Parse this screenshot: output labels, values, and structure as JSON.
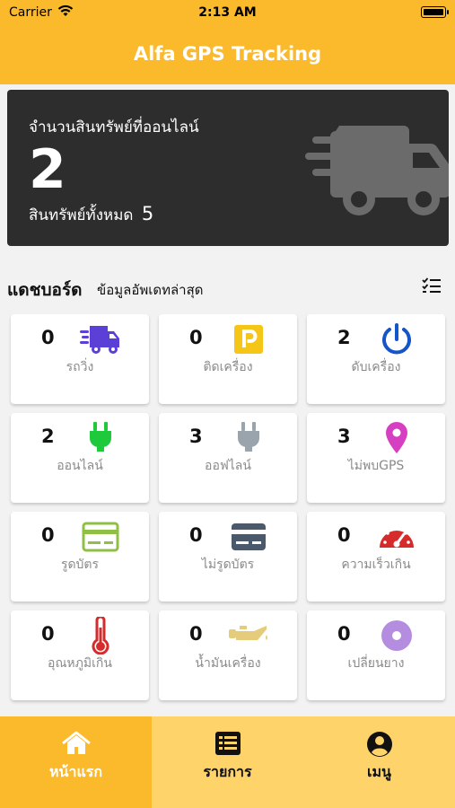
{
  "status_bar": {
    "carrier": "Carrier",
    "time": "2:13 AM"
  },
  "nav": {
    "title": "Alfa GPS Tracking"
  },
  "summary": {
    "online_label": "จำนวนสินทรัพย์ที่ออนไลน์",
    "online_count": "2",
    "total_label": "สินทรัพย์ทั้งหมด",
    "total_count": "5",
    "icon": "truck-icon"
  },
  "dashboard": {
    "title": "แดชบอร์ด",
    "subtitle": "ข้อมูลอัพเดทล่าสุด",
    "filter_icon": "checklist-icon"
  },
  "cards": [
    {
      "count": "0",
      "label": "รถวิ่ง",
      "icon": "moving-truck-icon",
      "color": "#5b3fd6"
    },
    {
      "count": "0",
      "label": "ติดเครื่อง",
      "icon": "parking-icon",
      "color": "#f5c518"
    },
    {
      "count": "2",
      "label": "ดับเครื่อง",
      "icon": "power-icon",
      "color": "#1455c9"
    },
    {
      "count": "2",
      "label": "ออนไลน์",
      "icon": "plug-icon",
      "color": "#1ec93c"
    },
    {
      "count": "3",
      "label": "ออฟไลน์",
      "icon": "plug-icon",
      "color": "#9aa4ad"
    },
    {
      "count": "3",
      "label": "ไม่พบGPS",
      "icon": "map-pin-icon",
      "color": "#d63fc1"
    },
    {
      "count": "0",
      "label": "รูดบัตร",
      "icon": "card-icon",
      "color": "#8fbf45"
    },
    {
      "count": "0",
      "label": "ไม่รูดบัตร",
      "icon": "card-icon",
      "color": "#4a5a6c"
    },
    {
      "count": "0",
      "label": "ความเร็วเกิน",
      "icon": "speedometer-icon",
      "color": "#d62b2b"
    },
    {
      "count": "0",
      "label": "อุณหภูมิเกิน",
      "icon": "thermometer-icon",
      "color": "#d62b2b"
    },
    {
      "count": "0",
      "label": "น้ำมันเครื่อง",
      "icon": "oil-can-icon",
      "color": "#e5cc7a"
    },
    {
      "count": "0",
      "label": "เปลี่ยนยาง",
      "icon": "tire-icon",
      "color": "#b48ce0"
    }
  ],
  "tabs": [
    {
      "label": "หน้าแรก",
      "icon": "home-icon",
      "active": true
    },
    {
      "label": "รายการ",
      "icon": "list-icon",
      "active": false
    },
    {
      "label": "เมนู",
      "icon": "user-icon",
      "active": false
    }
  ],
  "colors": {
    "brand": "#fbb92c",
    "tab_bar": "#fdd36a",
    "hero_bg": "#2d2d2d"
  }
}
